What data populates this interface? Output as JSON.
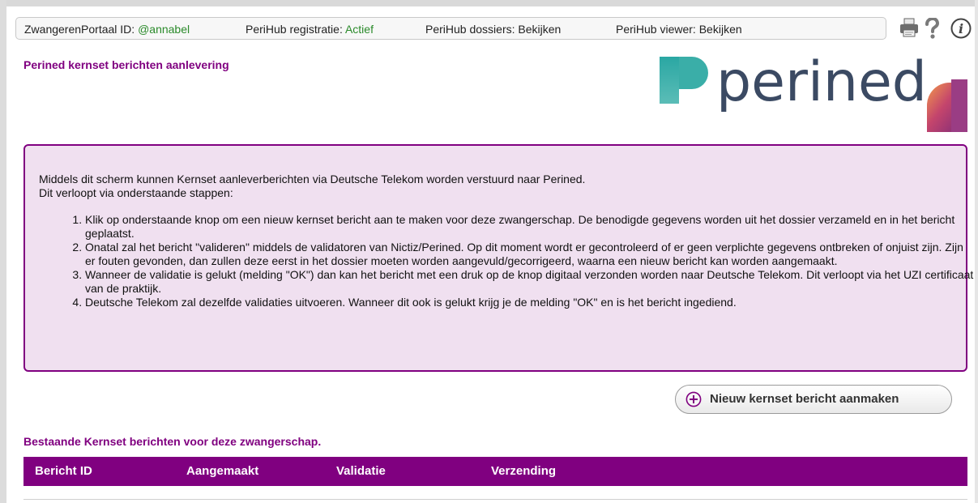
{
  "statusbar": {
    "portal_label": "ZwangerenPortaal ID:",
    "portal_id": "@annabel",
    "registration_label": "PeriHub registratie:",
    "registration_status": "Actief",
    "dossiers_label": "PeriHub dossiers:",
    "dossiers_link": "Bekijken",
    "viewer_label": "PeriHub viewer:",
    "viewer_link": "Bekijken"
  },
  "toolbar": {
    "icons": [
      "printer-icon",
      "help-icon",
      "info-icon"
    ]
  },
  "page": {
    "title": "Perined kernset berichten aanlevering"
  },
  "logo": {
    "text": "perined"
  },
  "info": {
    "intro_line1": "Middels dit scherm kunnen Kernset aanleverberichten via Deutsche Telekom worden verstuurd naar Perined.",
    "intro_line2": "Dit verloopt via onderstaande stappen:",
    "steps": [
      "Klik op onderstaande knop om een nieuw kernset bericht aan te maken voor deze zwangerschap. De benodigde gegevens worden uit het dossier verzameld en in het bericht geplaatst.",
      "Onatal zal het bericht \"valideren\" middels de validatoren van Nictiz/Perined. Op dit moment wordt er gecontroleerd of er geen verplichte gegevens ontbreken of onjuist zijn. Zijn er fouten gevonden, dan zullen deze eerst in het dossier moeten worden aangevuld/gecorrigeerd, waarna een nieuw bericht kan worden aangemaakt.",
      "Wanneer de validatie is gelukt (melding \"OK\") dan kan het bericht met een druk op de knop digitaal verzonden worden naar Deutsche Telekom. Dit verloopt via het UZI certificaat van de praktijk.",
      "Deutsche Telekom zal dezelfde validaties uitvoeren. Wanneer dit ook is gelukt krijg je de melding \"OK\" en is het bericht ingediend."
    ]
  },
  "actions": {
    "new_label": "Nieuw kernset bericht aanmaken"
  },
  "existing": {
    "title": "Bestaande Kernset berichten voor deze zwangerschap.",
    "columns": [
      "Bericht ID",
      "Aangemaakt",
      "Validatie",
      "Verzending"
    ]
  },
  "colors": {
    "accent": "#800080",
    "info_bg": "#f0e0f0",
    "status_green": "#2a8a2a"
  }
}
